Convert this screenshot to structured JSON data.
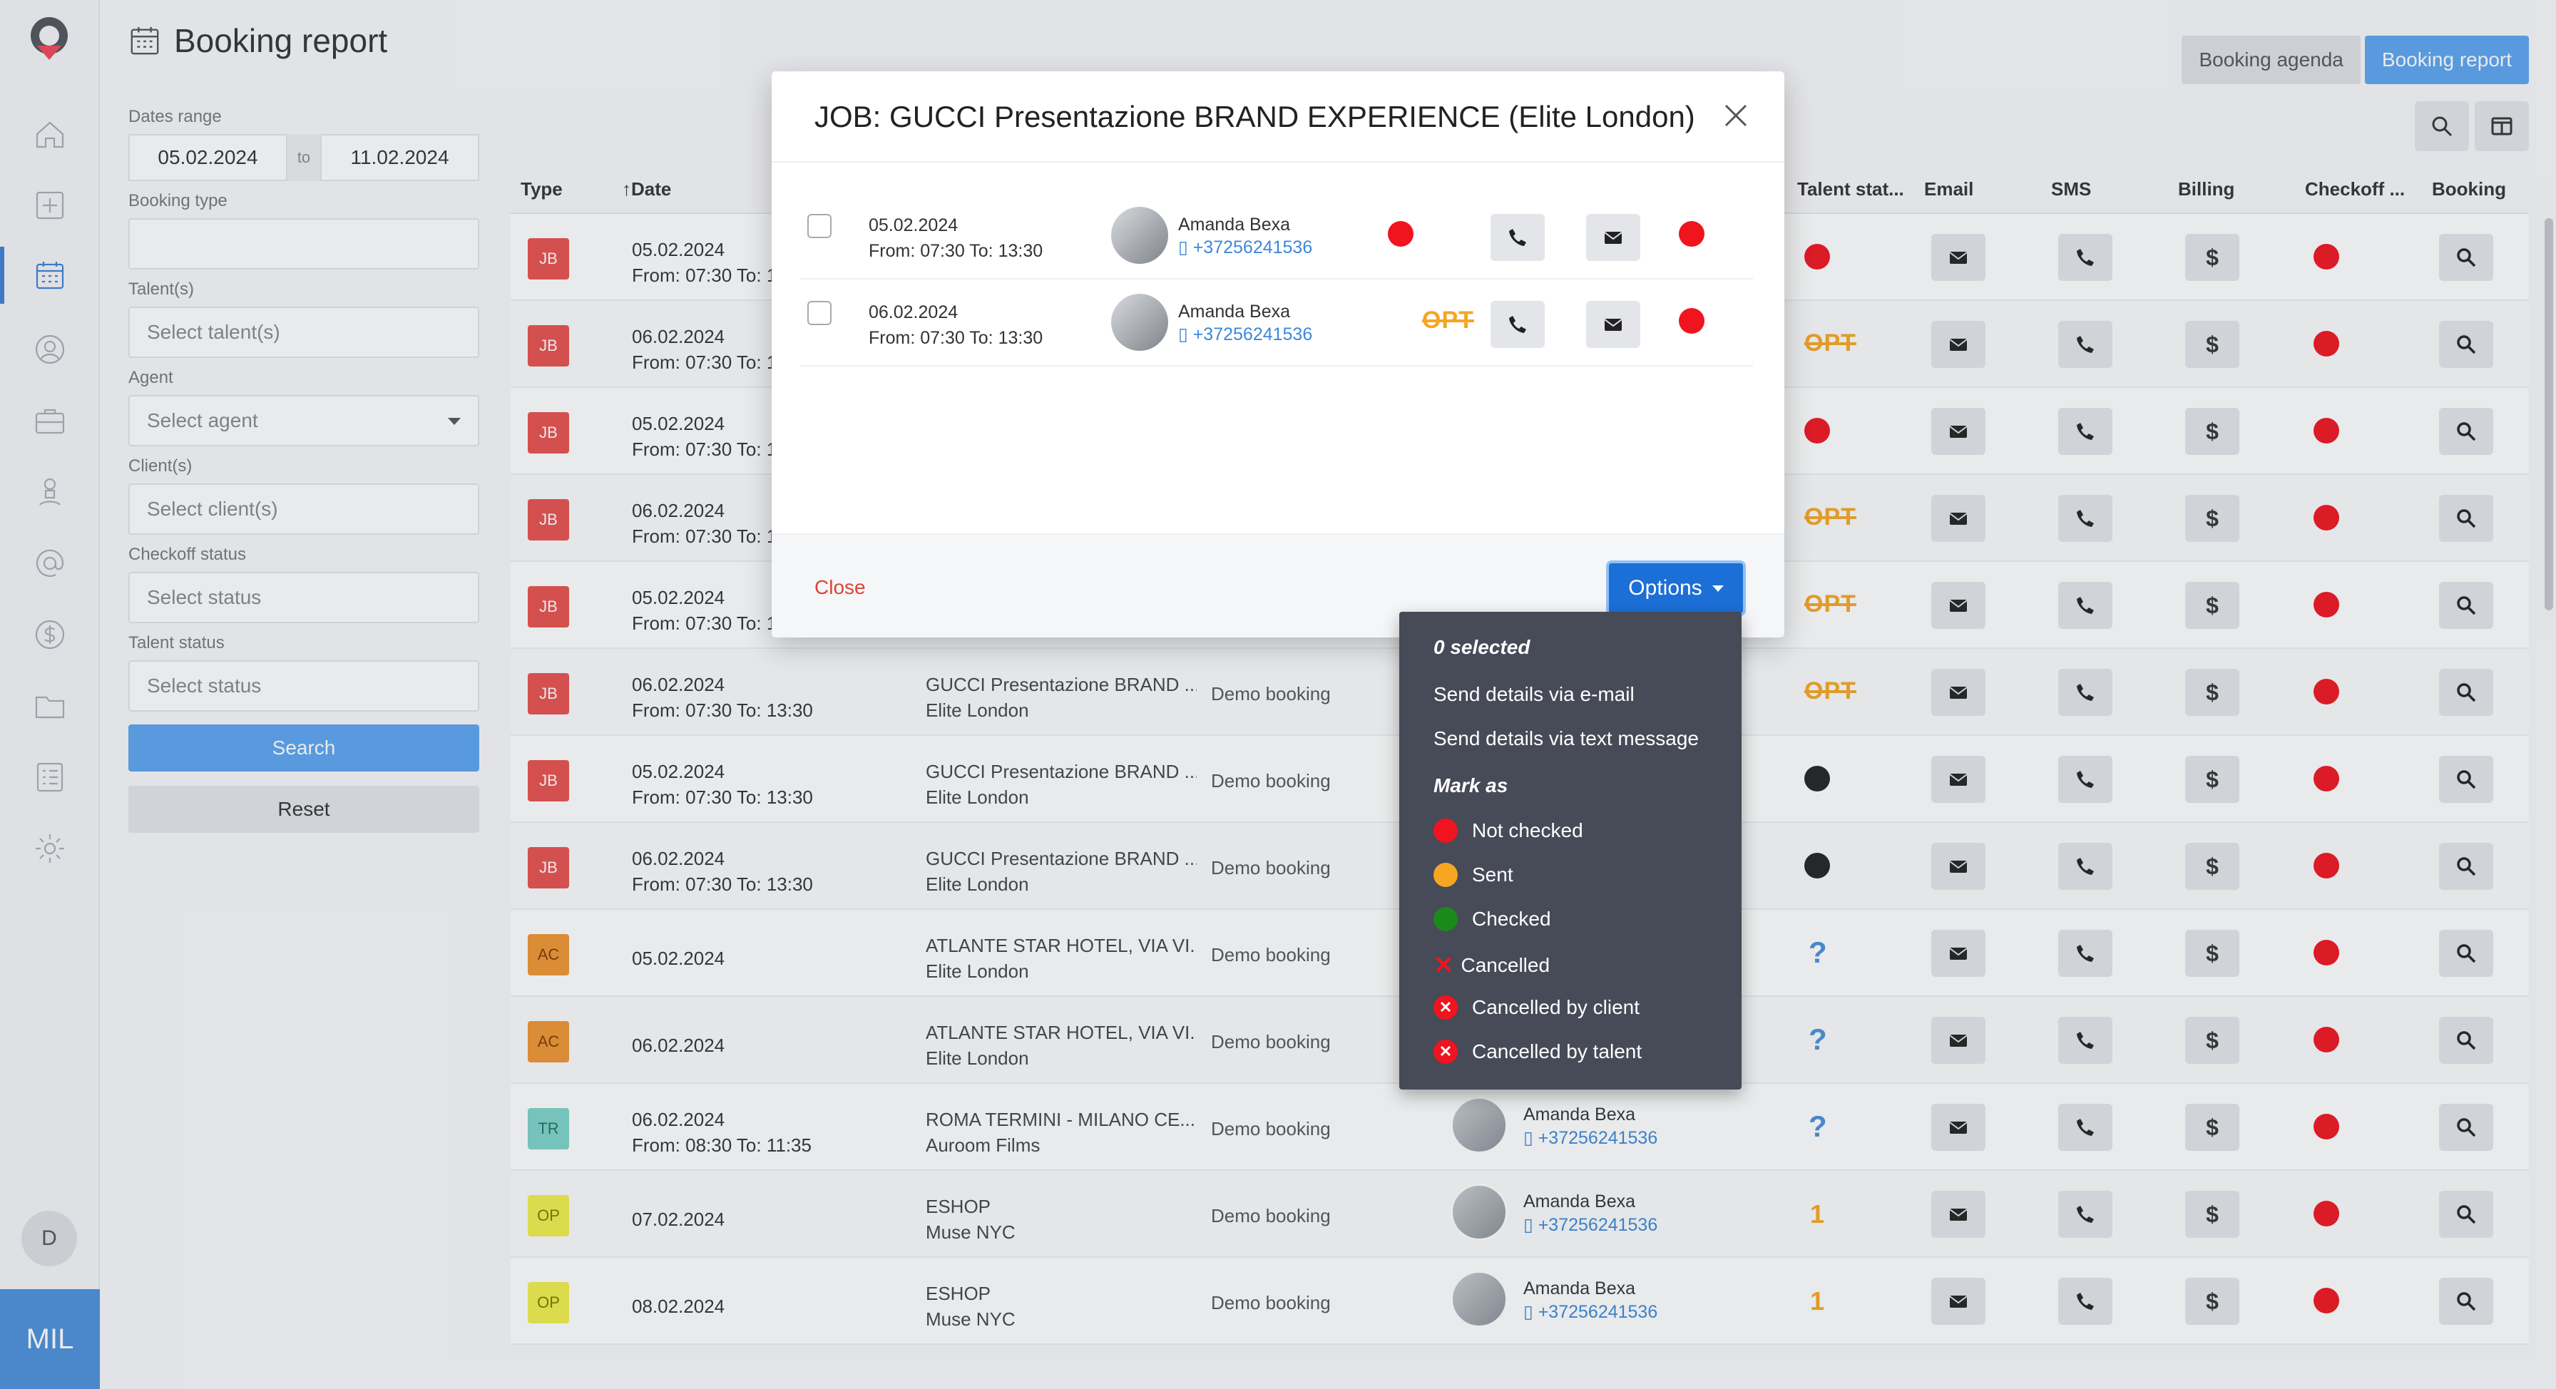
{
  "app": {
    "workspace_label": "MIL",
    "user_initial": "D"
  },
  "page": {
    "title": "Booking report"
  },
  "top_tabs": [
    {
      "label": "Booking agenda"
    },
    {
      "label": "Booking report"
    }
  ],
  "filters": {
    "dates_range_label": "Dates range",
    "date_from": "05.02.2024",
    "to_label": "to",
    "date_to": "11.02.2024",
    "booking_type_label": "Booking type",
    "talents_label": "Talent(s)",
    "talents_placeholder": "Select talent(s)",
    "agent_label": "Agent",
    "agent_placeholder": "Select agent",
    "clients_label": "Client(s)",
    "clients_placeholder": "Select client(s)",
    "checkoff_label": "Checkoff status",
    "checkoff_placeholder": "Select status",
    "talent_status_label": "Talent status",
    "talent_status_placeholder": "Select status",
    "search_label": "Search",
    "reset_label": "Reset"
  },
  "table": {
    "headers": {
      "type": "Type",
      "date": "Date",
      "talent_status": "Talent stat...",
      "email": "Email",
      "sms": "SMS",
      "billing": "Billing",
      "checkoff": "Checkoff ...",
      "booking": "Booking"
    },
    "rows": [
      {
        "type": "JB",
        "date": "05.02.2024",
        "time": "From: 07:30 To: 13:30",
        "job": "",
        "client": "",
        "btype": "",
        "talent": "",
        "phone": "",
        "talent_status": "red-dot"
      },
      {
        "type": "JB",
        "date": "06.02.2024",
        "time": "From: 07:30 To: 13:30",
        "job": "",
        "client": "",
        "btype": "",
        "talent": "",
        "phone": "",
        "talent_status": "OPT"
      },
      {
        "type": "JB",
        "date": "05.02.2024",
        "time": "From: 07:30 To: 13:30",
        "job": "",
        "client": "",
        "btype": "",
        "talent": "",
        "phone": "",
        "talent_status": "red-dot"
      },
      {
        "type": "JB",
        "date": "06.02.2024",
        "time": "From: 07:30 To: 13:30",
        "job": "",
        "client": "",
        "btype": "",
        "talent": "",
        "phone": "",
        "talent_status": "OPT"
      },
      {
        "type": "JB",
        "date": "05.02.2024",
        "time": "From: 07:30 To: 13:30",
        "job": "",
        "client": "",
        "btype": "",
        "talent": "",
        "phone": "",
        "talent_status": "OPT"
      },
      {
        "type": "JB",
        "date": "06.02.2024",
        "time": "From: 07:30 To: 13:30",
        "job": "GUCCI Presentazione BRAND ...",
        "client": "Elite London",
        "btype": "Demo booking",
        "talent": "",
        "phone": "",
        "talent_status": "OPT"
      },
      {
        "type": "JB",
        "date": "05.02.2024",
        "time": "From: 07:30 To: 13:30",
        "job": "GUCCI Presentazione BRAND ...",
        "client": "Elite London",
        "btype": "Demo booking",
        "talent": "",
        "phone": "",
        "talent_status": "dark-dot"
      },
      {
        "type": "JB",
        "date": "06.02.2024",
        "time": "From: 07:30 To: 13:30",
        "job": "GUCCI Presentazione BRAND ...",
        "client": "Elite London",
        "btype": "Demo booking",
        "talent": "",
        "phone": "",
        "talent_status": "dark-dot"
      },
      {
        "type": "AC",
        "date": "05.02.2024",
        "time": "",
        "job": "ATLANTE STAR HOTEL, VIA VI...",
        "client": "Elite London",
        "btype": "Demo booking",
        "talent": "",
        "phone": "",
        "talent_status": "?"
      },
      {
        "type": "AC",
        "date": "06.02.2024",
        "time": "",
        "job": "ATLANTE STAR HOTEL, VIA VI...",
        "client": "Elite London",
        "btype": "Demo booking",
        "talent": "",
        "phone": "",
        "talent_status": "?"
      },
      {
        "type": "TR",
        "date": "06.02.2024",
        "time": "From: 08:30 To: 11:35",
        "job": "ROMA TERMINI - MILANO CE...",
        "client": "Auroom Films",
        "btype": "Demo booking",
        "talent": "Amanda Bexa",
        "phone": "+37256241536",
        "talent_status": "?"
      },
      {
        "type": "OP",
        "date": "07.02.2024",
        "time": "",
        "job": "ESHOP",
        "client": "Muse NYC",
        "btype": "Demo booking",
        "talent": "Amanda Bexa",
        "phone": "+37256241536",
        "talent_status": "1"
      },
      {
        "type": "OP",
        "date": "08.02.2024",
        "time": "",
        "job": "ESHOP",
        "client": "Muse NYC",
        "btype": "Demo booking",
        "talent": "Amanda Bexa",
        "phone": "+37256241536",
        "talent_status": "1"
      }
    ]
  },
  "modal": {
    "title": "JOB: GUCCI Presentazione BRAND EXPERIENCE (Elite London)",
    "rows": [
      {
        "date": "05.02.2024",
        "time": "From: 07:30 To: 13:30",
        "talent": "Amanda Bexa",
        "phone": "+37256241536",
        "status": "red-dot"
      },
      {
        "date": "06.02.2024",
        "time": "From: 07:30 To: 13:30",
        "talent": "Amanda Bexa",
        "phone": "+37256241536",
        "status": "OPT"
      }
    ],
    "close_label": "Close",
    "options_label": "Options"
  },
  "dropdown": {
    "selected_count": "0 selected",
    "send_email": "Send details via e-mail",
    "send_text": "Send details via text message",
    "mark_as": "Mark as",
    "marks": [
      {
        "label": "Not checked",
        "color": "#f0141e"
      },
      {
        "label": "Sent",
        "color": "#f5a623"
      },
      {
        "label": "Checked",
        "color": "#1a8a1a"
      },
      {
        "label": "Cancelled",
        "color": "#f0141e"
      },
      {
        "label": "Cancelled by client",
        "color": "#f0141e"
      },
      {
        "label": "Cancelled by talent",
        "color": "#f0141e"
      }
    ]
  },
  "colors": {
    "accent": "#5aa4ef",
    "primary": "#1c6fd6",
    "danger": "#f0141e",
    "warning": "#f5a623"
  }
}
